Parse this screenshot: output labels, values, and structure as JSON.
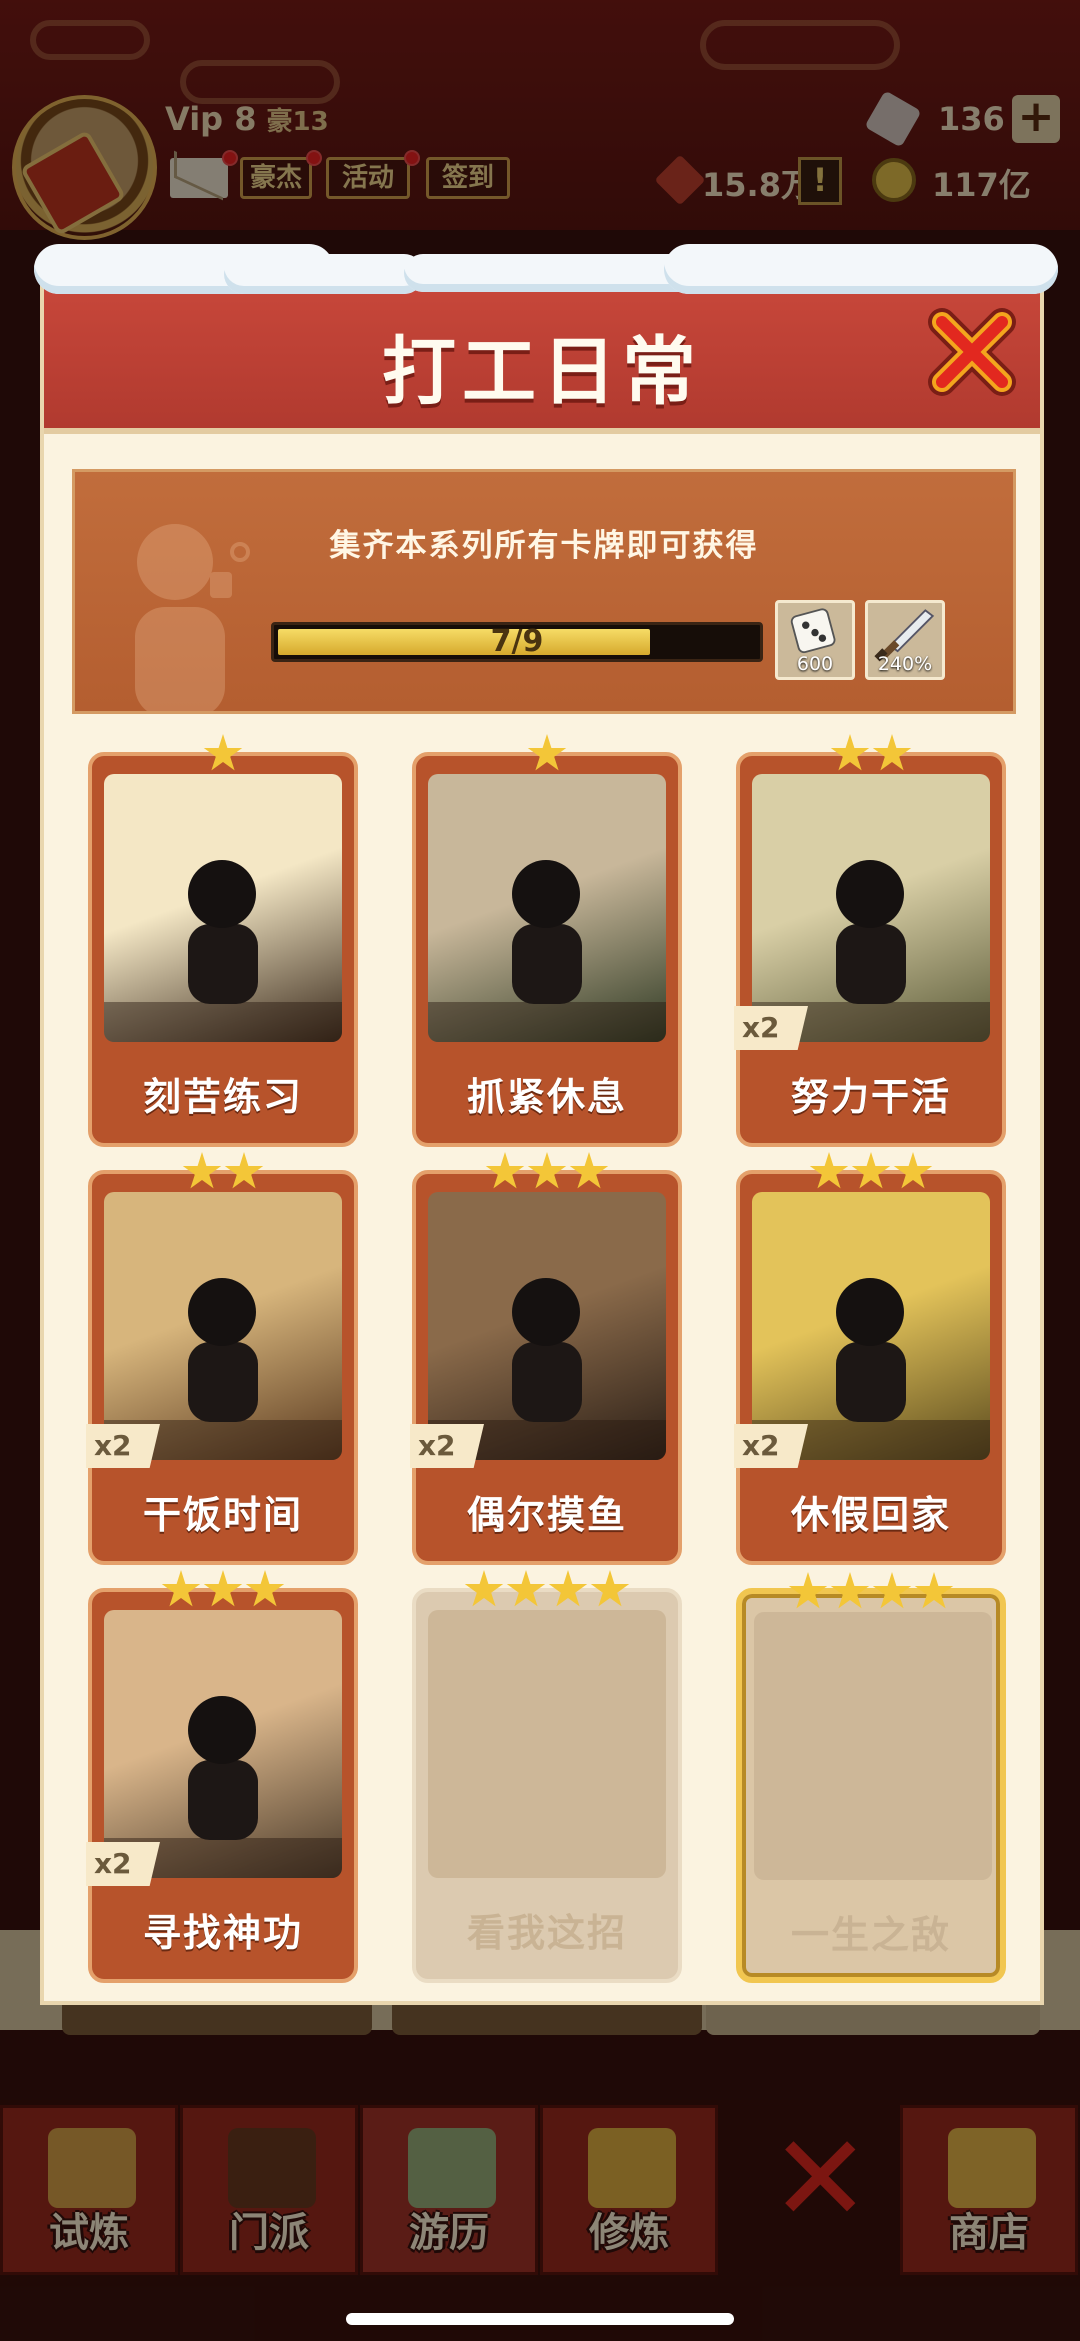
{
  "header": {
    "vip_label": "Vip 8",
    "rank_label": "豪13",
    "buttons": [
      "豪杰",
      "活动",
      "签到"
    ],
    "gems": "136",
    "power": "15.8万",
    "coins": "117亿"
  },
  "modal": {
    "title": "打工日常",
    "banner_text": "集齐本系列所有卡牌即可获得",
    "progress": {
      "current": 7,
      "total": 9,
      "label": "7/9",
      "fraction": 0.778
    },
    "rewards": [
      {
        "icon": "dice-icon",
        "value": "600"
      },
      {
        "icon": "sword-icon",
        "value": "240%"
      }
    ],
    "cards": [
      {
        "name": "刻苦练习",
        "stars": 1,
        "multiplier": "",
        "state": "owned",
        "palette": [
          "#f4e7c5",
          "#3a2a1c"
        ]
      },
      {
        "name": "抓紧休息",
        "stars": 1,
        "multiplier": "",
        "state": "owned",
        "palette": [
          "#c8b79a",
          "#2f3a24"
        ]
      },
      {
        "name": "努力干活",
        "stars": 2,
        "multiplier": "x2",
        "state": "owned",
        "palette": [
          "#d9cfa6",
          "#5a5a38"
        ]
      },
      {
        "name": "干饭时间",
        "stars": 2,
        "multiplier": "x2",
        "state": "owned",
        "palette": [
          "#d7b57c",
          "#5a3a20"
        ]
      },
      {
        "name": "偶尔摸鱼",
        "stars": 3,
        "multiplier": "x2",
        "state": "owned",
        "palette": [
          "#8a6a4a",
          "#2a1e16"
        ]
      },
      {
        "name": "休假回家",
        "stars": 3,
        "multiplier": "x2",
        "state": "owned",
        "palette": [
          "#e3c35a",
          "#5a4a1e"
        ]
      },
      {
        "name": "寻找神功",
        "stars": 3,
        "multiplier": "x2",
        "state": "owned",
        "palette": [
          "#d9b58a",
          "#4a3a2a"
        ]
      },
      {
        "name": "看我这招",
        "stars": 4,
        "multiplier": "",
        "state": "locked",
        "palette": []
      },
      {
        "name": "一生之敌",
        "stars": 4,
        "multiplier": "",
        "state": "locked-gold",
        "palette": []
      }
    ]
  },
  "bottom_nav": [
    "试炼",
    "门派",
    "游历",
    "修炼",
    "商店"
  ],
  "colors": {
    "header_red": "#b13a2f",
    "card_orange": "#b7532b",
    "star_gold": "#f3c638",
    "modal_bg": "#fbf3e0"
  }
}
